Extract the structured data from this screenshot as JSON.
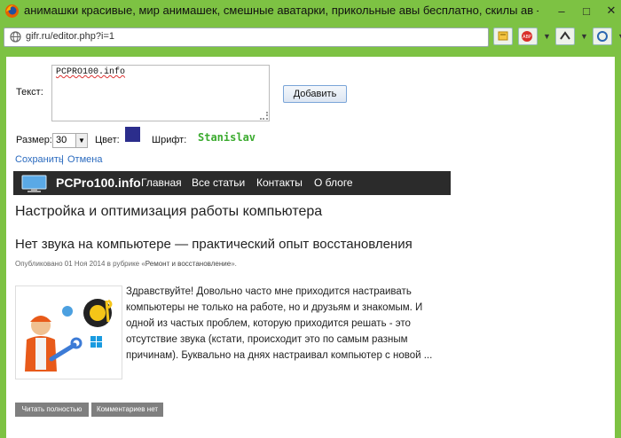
{
  "window": {
    "title": "анимашки красивые, мир анимашек, смешные аватарки, прикольные авы бесплатно, скилы ав - Mozi...",
    "minimize": "–",
    "maximize": "□",
    "close": "✕"
  },
  "browser": {
    "url": "gifr.ru/editor.php?i=1",
    "toolbar_icons": [
      "feed-icon",
      "adblock-icon",
      "addon-icon",
      "menu-icon"
    ]
  },
  "editor": {
    "text_label": "Текст:",
    "text_value": "PCPRO100.info",
    "add_button": "Добавить",
    "size_label": "Размер:",
    "size_value": "30",
    "color_label": "Цвет:",
    "color_value": "#2b2d8c",
    "font_label": "Шрифт:",
    "font_value": "Stanislav",
    "save_link": "Сохранить",
    "separator": "|",
    "cancel_link": "Отмена"
  },
  "site": {
    "name": "PCPro100.info",
    "nav": [
      "Главная",
      "Все статьи",
      "Контакты",
      "О блоге"
    ],
    "heading": "Настройка и оптимизация работы компьютера",
    "post_title": "Нет звука на компьютере — практический опыт восстановления",
    "meta_prefix": "Опубликовано 01 Ноя 2014 в рубрике «",
    "meta_category": "Ремонт и восстановление",
    "meta_suffix": "».",
    "excerpt": "Здравствуйте! Довольно часто мне приходится настраивать компьютеры не только на работе, но и друзьям и знакомым. И одной из частых проблем, которую приходится решать - это отсутствие звука (кстати, происходит это по самым разным причинам). Буквально на днях настраивал компьютер с новой ...",
    "read_more": "Читать полностью",
    "no_comments": "Комментариев нет"
  }
}
